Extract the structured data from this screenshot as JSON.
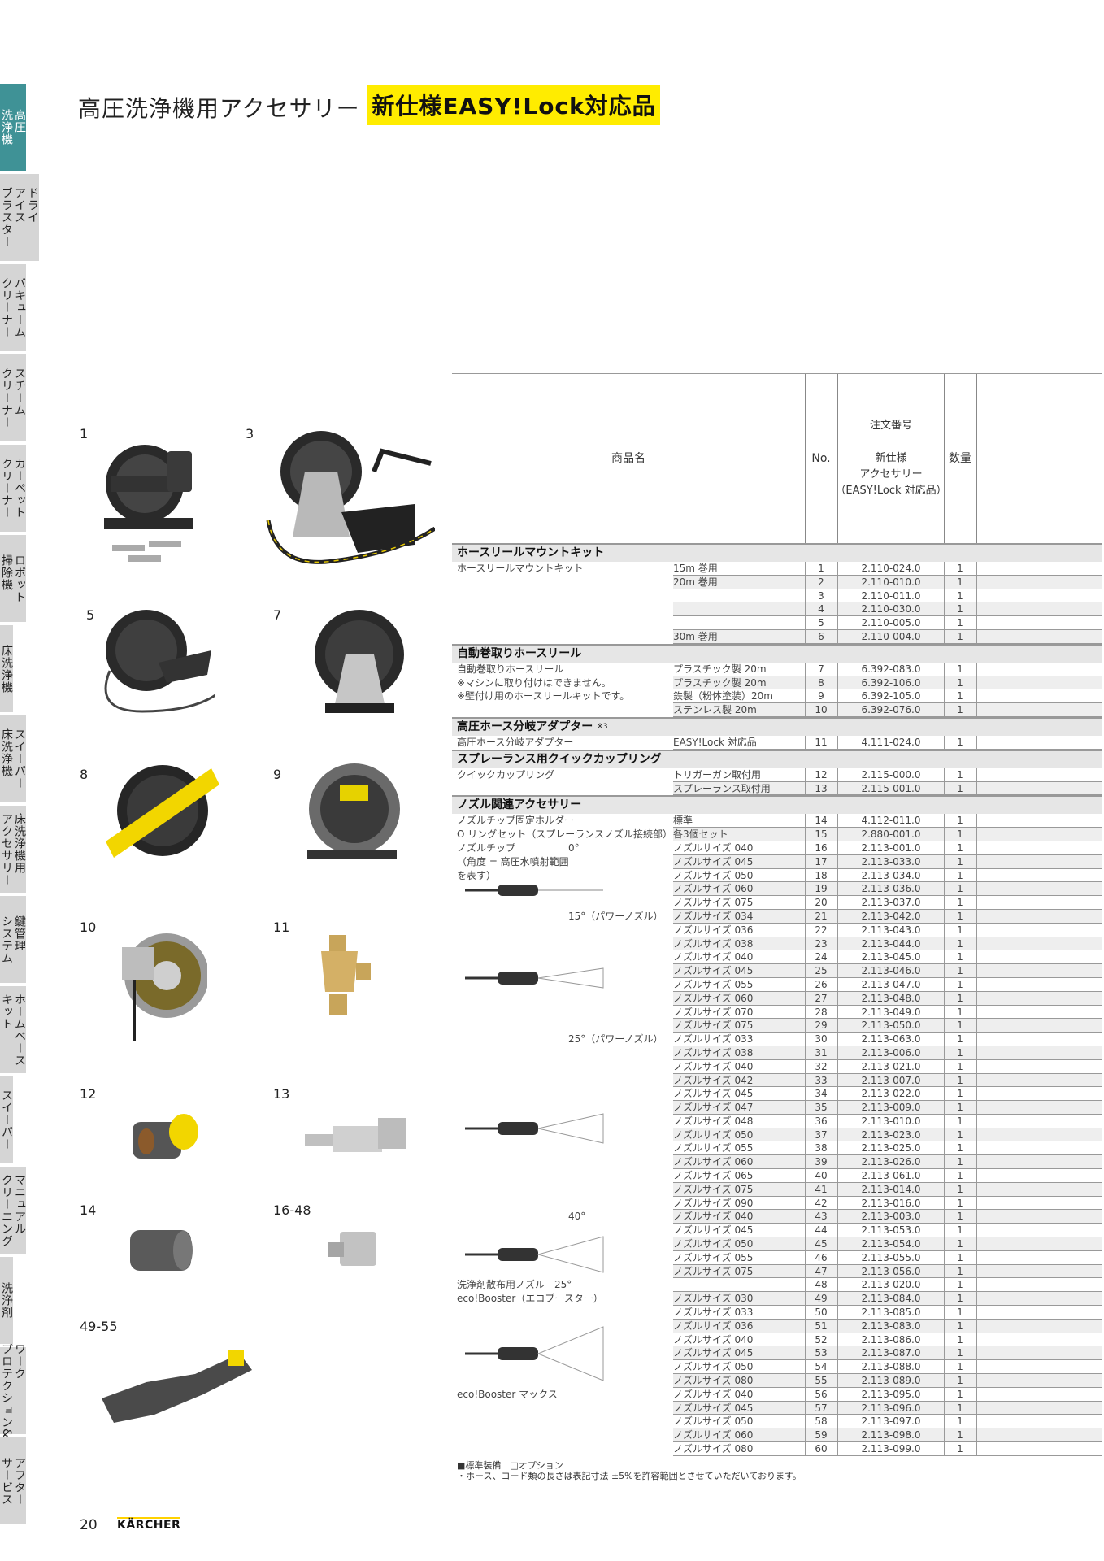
{
  "sidebar": {
    "tabs": [
      {
        "label": "高圧\n洗浄機",
        "active": true
      },
      {
        "label": "ドライ\nアイス\nブラスター",
        "active": false
      },
      {
        "label": "バキューム\nクリーナー",
        "active": false
      },
      {
        "label": "スチーム\nクリーナー",
        "active": false
      },
      {
        "label": "カーペット\nクリーナー",
        "active": false
      },
      {
        "label": "ロボット\n掃除機",
        "active": false
      },
      {
        "label": "床洗浄機",
        "active": false
      },
      {
        "label": "スイーパー\n床洗浄機",
        "active": false
      },
      {
        "label": "床洗浄機用\nアクセサリー",
        "active": false
      },
      {
        "label": "鍵管理\nシステム",
        "active": false
      },
      {
        "label": "ホームベース\nキット",
        "active": false
      },
      {
        "label": "スイーパー",
        "active": false
      },
      {
        "label": "マニュアル\nクリーニング",
        "active": false
      },
      {
        "label": "洗浄剤",
        "active": false
      },
      {
        "label": "ワーク\nプロテクション&",
        "active": false
      },
      {
        "label": "アフター\nサービス",
        "active": false
      }
    ]
  },
  "header": {
    "title": "高圧洗浄機用アクセサリー",
    "badge": "新仕様EASY!Lock対応品"
  },
  "products": [
    "1",
    "3",
    "5",
    "7",
    "8",
    "9",
    "10",
    "11",
    "12",
    "13",
    "14",
    "16-48",
    "49-55"
  ],
  "table": {
    "headers": {
      "name": "商品名",
      "no": "No.",
      "code": "注文番号\n\n新仕様\nアクセサリー\n（EASY!Lock 対応品）",
      "qty": "数量"
    },
    "sections": [
      {
        "title": "ホースリールマウントキット",
        "note": "",
        "rows": [
          {
            "name": "ホースリールマウントキット",
            "spec": "15m 巻用",
            "no": "1",
            "code": "2.110-024.0",
            "qty": "1"
          },
          {
            "name": "",
            "spec": "20m 巻用",
            "no": "2",
            "code": "2.110-010.0",
            "qty": "1"
          },
          {
            "name": "",
            "spec": "",
            "no": "3",
            "code": "2.110-011.0",
            "qty": "1"
          },
          {
            "name": "",
            "spec": "",
            "no": "4",
            "code": "2.110-030.0",
            "qty": "1"
          },
          {
            "name": "",
            "spec": "",
            "no": "5",
            "code": "2.110-005.0",
            "qty": "1"
          },
          {
            "name": "",
            "spec": "30m 巻用",
            "no": "6",
            "code": "2.110-004.0",
            "qty": "1"
          }
        ]
      },
      {
        "title": "自動巻取りホースリール",
        "note": "",
        "rows": [
          {
            "name": "自動巻取りホースリール",
            "spec": "プラスチック製 20m",
            "no": "7",
            "code": "6.392-083.0",
            "qty": "1"
          },
          {
            "name": "※マシンに取り付けはできません。",
            "spec": "プラスチック製 20m",
            "no": "8",
            "code": "6.392-106.0",
            "qty": "1"
          },
          {
            "name": "※壁付け用のホースリールキットです。",
            "spec": "鉄製（粉体塗装）20m",
            "no": "9",
            "code": "6.392-105.0",
            "qty": "1"
          },
          {
            "name": "",
            "spec": "ステンレス製 20m",
            "no": "10",
            "code": "6.392-076.0",
            "qty": "1"
          }
        ]
      },
      {
        "title": "高圧ホース分岐アダプター",
        "note": "※3",
        "rows": [
          {
            "name": "高圧ホース分岐アダプター",
            "spec": "EASY!Lock 対応品",
            "no": "11",
            "code": "4.111-024.0",
            "qty": "1"
          }
        ]
      },
      {
        "title": "スプレーランス用クイックカップリング",
        "note": "",
        "rows": [
          {
            "name": "クイックカップリング",
            "spec": "トリガーガン取付用",
            "no": "12",
            "code": "2.115-000.0",
            "qty": "1"
          },
          {
            "name": "",
            "spec": "スプレーランス取付用",
            "no": "13",
            "code": "2.115-001.0",
            "qty": "1"
          }
        ]
      },
      {
        "title": "ノズル関連アクセサリー",
        "note": "",
        "rows": [
          {
            "name": "ノズルチップ固定ホルダー",
            "spec": "標準",
            "no": "14",
            "code": "4.112-011.0",
            "qty": "1"
          },
          {
            "name": "O リングセット（スプレーランスノズル接続部）",
            "spec": "各3個セット",
            "no": "15",
            "code": "2.880-001.0",
            "qty": "1"
          },
          {
            "name": "ノズルチップ",
            "sub": "0°",
            "spec": "ノズルサイズ 040",
            "no": "16",
            "code": "2.113-001.0",
            "qty": "1"
          },
          {
            "name": "（角度 = 高圧水噴射範囲",
            "spec": "ノズルサイズ 045",
            "no": "17",
            "code": "2.113-033.0",
            "qty": "1"
          },
          {
            "name": "を表す）",
            "spec": "ノズルサイズ 050",
            "no": "18",
            "code": "2.113-034.0",
            "qty": "1"
          },
          {
            "name": "",
            "spec": "ノズルサイズ 060",
            "no": "19",
            "code": "2.113-036.0",
            "qty": "1"
          },
          {
            "name": "",
            "spec": "ノズルサイズ 075",
            "no": "20",
            "code": "2.113-037.0",
            "qty": "1"
          },
          {
            "name": "",
            "sub": "15°（パワーノズル）",
            "spec": "ノズルサイズ 034",
            "no": "21",
            "code": "2.113-042.0",
            "qty": "1"
          },
          {
            "name": "",
            "spec": "ノズルサイズ 036",
            "no": "22",
            "code": "2.113-043.0",
            "qty": "1"
          },
          {
            "name": "",
            "spec": "ノズルサイズ 038",
            "no": "23",
            "code": "2.113-044.0",
            "qty": "1"
          },
          {
            "name": "",
            "spec": "ノズルサイズ 040",
            "no": "24",
            "code": "2.113-045.0",
            "qty": "1"
          },
          {
            "name": "",
            "spec": "ノズルサイズ 045",
            "no": "25",
            "code": "2.113-046.0",
            "qty": "1"
          },
          {
            "name": "",
            "spec": "ノズルサイズ 055",
            "no": "26",
            "code": "2.113-047.0",
            "qty": "1"
          },
          {
            "name": "",
            "spec": "ノズルサイズ 060",
            "no": "27",
            "code": "2.113-048.0",
            "qty": "1"
          },
          {
            "name": "",
            "spec": "ノズルサイズ 070",
            "no": "28",
            "code": "2.113-049.0",
            "qty": "1"
          },
          {
            "name": "",
            "spec": "ノズルサイズ 075",
            "no": "29",
            "code": "2.113-050.0",
            "qty": "1"
          },
          {
            "name": "",
            "sub": "25°（パワーノズル）",
            "spec": "ノズルサイズ 033",
            "no": "30",
            "code": "2.113-063.0",
            "qty": "1"
          },
          {
            "name": "",
            "spec": "ノズルサイズ 038",
            "no": "31",
            "code": "2.113-006.0",
            "qty": "1"
          },
          {
            "name": "",
            "spec": "ノズルサイズ 040",
            "no": "32",
            "code": "2.113-021.0",
            "qty": "1"
          },
          {
            "name": "",
            "spec": "ノズルサイズ 042",
            "no": "33",
            "code": "2.113-007.0",
            "qty": "1"
          },
          {
            "name": "",
            "spec": "ノズルサイズ 045",
            "no": "34",
            "code": "2.113-022.0",
            "qty": "1"
          },
          {
            "name": "",
            "spec": "ノズルサイズ 047",
            "no": "35",
            "code": "2.113-009.0",
            "qty": "1"
          },
          {
            "name": "",
            "spec": "ノズルサイズ 048",
            "no": "36",
            "code": "2.113-010.0",
            "qty": "1"
          },
          {
            "name": "",
            "spec": "ノズルサイズ 050",
            "no": "37",
            "code": "2.113-023.0",
            "qty": "1"
          },
          {
            "name": "",
            "spec": "ノズルサイズ 055",
            "no": "38",
            "code": "2.113-025.0",
            "qty": "1"
          },
          {
            "name": "",
            "spec": "ノズルサイズ 060",
            "no": "39",
            "code": "2.113-026.0",
            "qty": "1"
          },
          {
            "name": "",
            "spec": "ノズルサイズ 065",
            "no": "40",
            "code": "2.113-061.0",
            "qty": "1"
          },
          {
            "name": "",
            "spec": "ノズルサイズ 075",
            "no": "41",
            "code": "2.113-014.0",
            "qty": "1"
          },
          {
            "name": "",
            "spec": "ノズルサイズ 090",
            "no": "42",
            "code": "2.113-016.0",
            "qty": "1"
          },
          {
            "name": "",
            "sub": "40°",
            "spec": "ノズルサイズ 040",
            "no": "43",
            "code": "2.113-003.0",
            "qty": "1"
          },
          {
            "name": "",
            "spec": "ノズルサイズ 045",
            "no": "44",
            "code": "2.113-053.0",
            "qty": "1"
          },
          {
            "name": "",
            "spec": "ノズルサイズ 050",
            "no": "45",
            "code": "2.113-054.0",
            "qty": "1"
          },
          {
            "name": "",
            "spec": "ノズルサイズ 055",
            "no": "46",
            "code": "2.113-055.0",
            "qty": "1"
          },
          {
            "name": "",
            "spec": "ノズルサイズ 075",
            "no": "47",
            "code": "2.113-056.0",
            "qty": "1"
          },
          {
            "name": "洗浄剤散布用ノズル　25°",
            "spec": "",
            "no": "48",
            "code": "2.113-020.0",
            "qty": "1"
          },
          {
            "name": "eco!Booster（エコブースター）",
            "spec": "ノズルサイズ 030",
            "no": "49",
            "code": "2.113-084.0",
            "qty": "1"
          },
          {
            "name": "",
            "spec": "ノズルサイズ 033",
            "no": "50",
            "code": "2.113-085.0",
            "qty": "1"
          },
          {
            "name": "",
            "spec": "ノズルサイズ 036",
            "no": "51",
            "code": "2.113-083.0",
            "qty": "1"
          },
          {
            "name": "",
            "spec": "ノズルサイズ 040",
            "no": "52",
            "code": "2.113-086.0",
            "qty": "1"
          },
          {
            "name": "",
            "spec": "ノズルサイズ 045",
            "no": "53",
            "code": "2.113-087.0",
            "qty": "1"
          },
          {
            "name": "",
            "spec": "ノズルサイズ 050",
            "no": "54",
            "code": "2.113-088.0",
            "qty": "1"
          },
          {
            "name": "",
            "spec": "ノズルサイズ 080",
            "no": "55",
            "code": "2.113-089.0",
            "qty": "1"
          },
          {
            "name": "eco!Booster マックス",
            "spec": "ノズルサイズ 040",
            "no": "56",
            "code": "2.113-095.0",
            "qty": "1"
          },
          {
            "name": "",
            "spec": "ノズルサイズ 045",
            "no": "57",
            "code": "2.113-096.0",
            "qty": "1"
          },
          {
            "name": "",
            "spec": "ノズルサイズ 050",
            "no": "58",
            "code": "2.113-097.0",
            "qty": "1"
          },
          {
            "name": "",
            "spec": "ノズルサイズ 060",
            "no": "59",
            "code": "2.113-098.0",
            "qty": "1"
          },
          {
            "name": "",
            "spec": "ノズルサイズ 080",
            "no": "60",
            "code": "2.113-099.0",
            "qty": "1"
          }
        ]
      }
    ]
  },
  "footnotes": {
    "legend": "■標準装備　□オプション",
    "note": "・ホース、コード類の長さは表記寸法 ±5%を許容範囲とさせていただいております。"
  },
  "page": {
    "number": "20",
    "brand": "KÄRCHER"
  },
  "colors": {
    "accent": "#3f9296",
    "badge": "#ffec00"
  }
}
